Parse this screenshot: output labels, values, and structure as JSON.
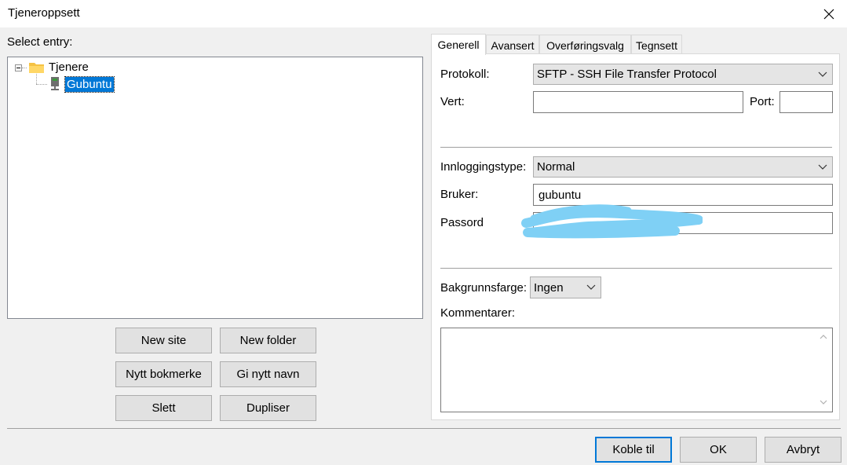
{
  "window": {
    "title": "Tjeneroppsett"
  },
  "left": {
    "select_entry_label": "Select entry:",
    "tree": {
      "folder": {
        "label": "Tjenere",
        "icon": "folder-icon"
      },
      "site": {
        "label": "Gubuntu",
        "icon": "server-icon",
        "selected": true
      }
    },
    "buttons": {
      "new_site": "New site",
      "new_folder": "New folder",
      "new_bookmark": "Nytt bokmerke",
      "rename": "Gi nytt navn",
      "delete": "Slett",
      "duplicate": "Dupliser"
    }
  },
  "tabs": [
    {
      "label": "Generell",
      "active": true
    },
    {
      "label": "Avansert",
      "active": false
    },
    {
      "label": "Overføringsvalg",
      "active": false
    },
    {
      "label": "Tegnsett",
      "active": false
    }
  ],
  "general": {
    "protocol_label": "Protokoll:",
    "protocol_value": "SFTP - SSH File Transfer Protocol",
    "host_label": "Vert:",
    "host_value": "",
    "port_label": "Port:",
    "port_value": "",
    "logon_type_label": "Innloggingstype:",
    "logon_type_value": "Normal",
    "user_label": "Bruker:",
    "user_value": "gubuntu",
    "password_label": "Passord",
    "password_value": "",
    "bg_color_label": "Bakgrunnsfarge:",
    "bg_color_value": "Ingen",
    "comments_label": "Kommentarer:",
    "comments_value": ""
  },
  "footer": {
    "connect": "Koble til",
    "ok": "OK",
    "cancel": "Avbryt"
  },
  "colors": {
    "selection": "#0078d7",
    "redaction": "#7fd0f5",
    "folder": "#f5c243"
  }
}
